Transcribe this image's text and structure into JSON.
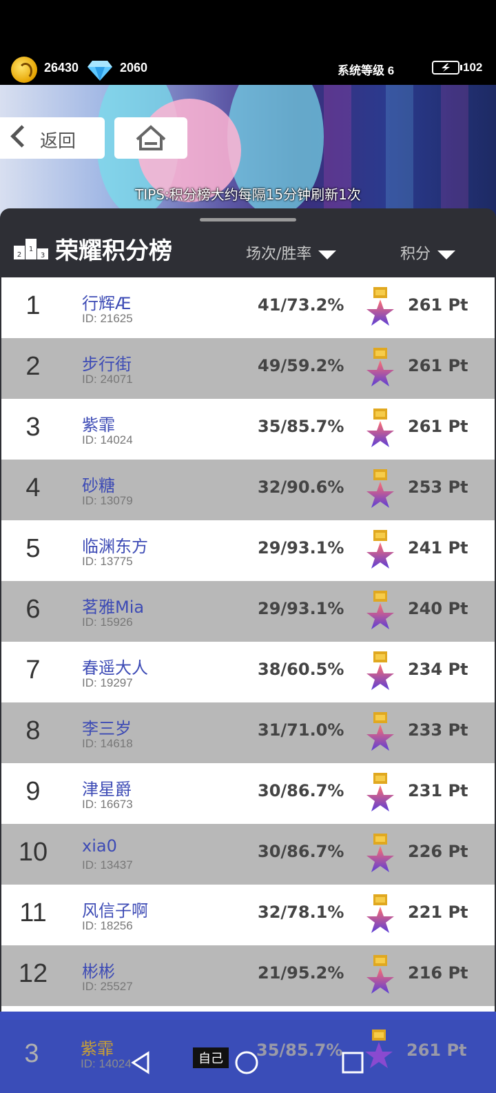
{
  "header": {
    "coins": "26430",
    "gems": "2060",
    "system_level": "系统等级 6",
    "energy": "102"
  },
  "banner": {
    "back_label": "返回",
    "tips": "TIPS:积分榜大约每隔15分钟刷新1次"
  },
  "leaderboard": {
    "title": "荣耀积分榜",
    "sort_matches": "场次/胜率",
    "sort_points": "积分",
    "rows": [
      {
        "rank": "1",
        "name": "行辉Æ",
        "id": "ID: 21625",
        "record": "41/73.2%",
        "points": "261 Pt"
      },
      {
        "rank": "2",
        "name": "步行街",
        "id": "ID: 24071",
        "record": "49/59.2%",
        "points": "261 Pt"
      },
      {
        "rank": "3",
        "name": "紫霏",
        "id": "ID: 14024",
        "record": "35/85.7%",
        "points": "261 Pt"
      },
      {
        "rank": "4",
        "name": "砂糖",
        "id": "ID: 13079",
        "record": "32/90.6%",
        "points": "253 Pt"
      },
      {
        "rank": "5",
        "name": "临渊东方",
        "id": "ID: 13775",
        "record": "29/93.1%",
        "points": "241 Pt"
      },
      {
        "rank": "6",
        "name": "茗雅Mia",
        "id": "ID: 15926",
        "record": "29/93.1%",
        "points": "240 Pt"
      },
      {
        "rank": "7",
        "name": "春遥大人",
        "id": "ID: 19297",
        "record": "38/60.5%",
        "points": "234 Pt"
      },
      {
        "rank": "8",
        "name": "李三岁",
        "id": "ID: 14618",
        "record": "31/71.0%",
        "points": "233 Pt"
      },
      {
        "rank": "9",
        "name": "津星爵",
        "id": "ID: 16673",
        "record": "30/86.7%",
        "points": "231 Pt"
      },
      {
        "rank": "10",
        "name": "xia0",
        "id": "ID: 13437",
        "record": "30/86.7%",
        "points": "226 Pt"
      },
      {
        "rank": "11",
        "name": "风信子啊",
        "id": "ID: 18256",
        "record": "32/78.1%",
        "points": "221 Pt"
      },
      {
        "rank": "12",
        "name": "彬彬",
        "id": "ID: 25527",
        "record": "21/95.2%",
        "points": "216 Pt"
      }
    ]
  },
  "self": {
    "rank": "3",
    "name": "紫霏",
    "id": "ID: 14024",
    "record": "35/85.7%",
    "points": "261 Pt",
    "tag": "自己"
  },
  "colors": {
    "accent_blue": "#3a4db8",
    "name_blue": "#3d4bb5",
    "panel": "#2e2f35"
  },
  "icons": [
    "coin-icon",
    "diamond-icon",
    "battery-icon",
    "back-chevron-icon",
    "home-icon",
    "podium-icon",
    "sort-triangle-icon",
    "medal-icon",
    "nav-back-icon",
    "nav-home-icon",
    "nav-recents-icon"
  ]
}
